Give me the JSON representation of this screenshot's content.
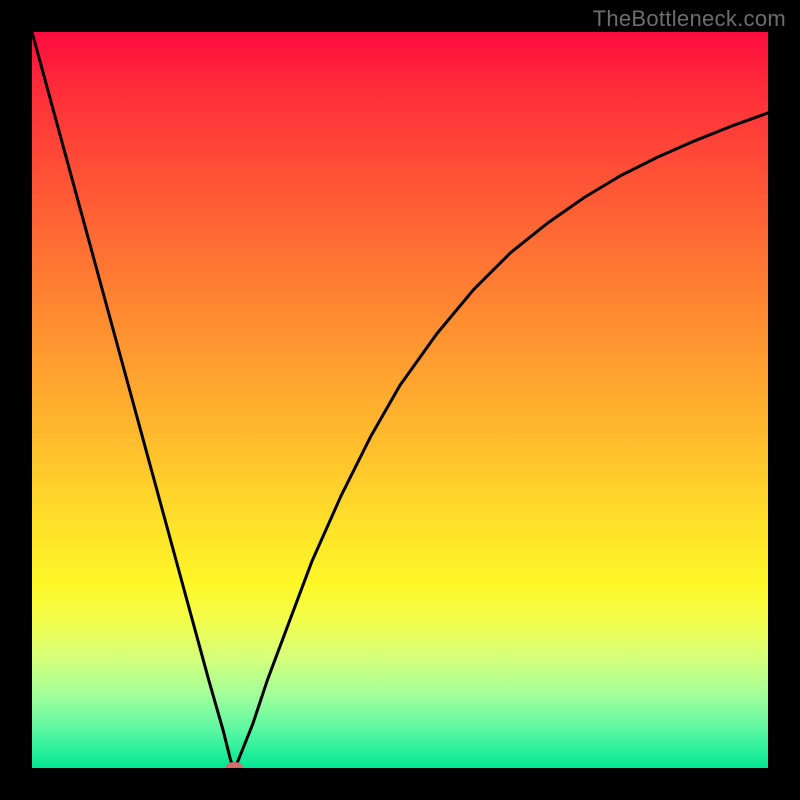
{
  "watermark": "TheBottleneck.com",
  "colors": {
    "frame": "#000000",
    "gradient_top": "#ff0b3f",
    "gradient_bottom": "#00e793",
    "curve": "#000000",
    "marker": "#cf6f70"
  },
  "chart_data": {
    "type": "line",
    "title": "",
    "xlabel": "",
    "ylabel": "",
    "xlim": [
      0,
      100
    ],
    "ylim": [
      0,
      100
    ],
    "grid": false,
    "legend": null,
    "series": [
      {
        "name": "bottleneck-curve",
        "x": [
          0,
          3,
          6,
          9,
          12,
          15,
          18,
          21,
          24,
          26,
          27,
          27.5,
          28,
          30,
          32,
          35,
          38,
          42,
          46,
          50,
          55,
          60,
          65,
          70,
          75,
          80,
          85,
          90,
          95,
          100
        ],
        "values": [
          100,
          89,
          78,
          67,
          56,
          45,
          34,
          23,
          12,
          5,
          1,
          0,
          1,
          6,
          12,
          20,
          28,
          37,
          45,
          52,
          59,
          65,
          70,
          74,
          77.5,
          80.5,
          83,
          85.2,
          87.2,
          89
        ]
      }
    ],
    "marker": {
      "x": 27.5,
      "y": 0,
      "name": "optimal-point"
    }
  }
}
